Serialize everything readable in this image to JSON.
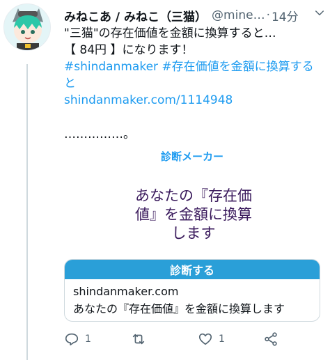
{
  "tweet": {
    "display_name": "みねこあ / みねこ（三猫）",
    "handle": "@mine…",
    "separator": "·",
    "timestamp": "14分",
    "text_line1": "\"三猫\"の存在価値を金額に換算すると…",
    "text_line2": "【 84円 】になります！",
    "hashtag1": "#shindanmaker",
    "hashtag2": " #存在価値を金額に換算する",
    "hashtag2_cont": "と",
    "link": "shindanmaker.com/1114948",
    "dots": "……………。"
  },
  "card": {
    "brand": "診断メーカー",
    "body_line1": "あなたの『存在価",
    "body_line2": "値』を金額に換算",
    "body_line3": "します",
    "button_label": "診断する",
    "domain": "shindanmaker.com",
    "title": "あなたの『存在価値』を金額に換算します"
  },
  "actions": {
    "reply_count": "1",
    "retweet_count": "",
    "like_count": "1"
  },
  "colors": {
    "accent": "#1d9bf0",
    "card_button": "#2a9fd8",
    "muted": "#536471",
    "card_text": "#3a1a5c"
  },
  "icons": [
    "avatar",
    "more-icon",
    "reply-icon",
    "retweet-icon",
    "like-icon",
    "share-icon"
  ]
}
